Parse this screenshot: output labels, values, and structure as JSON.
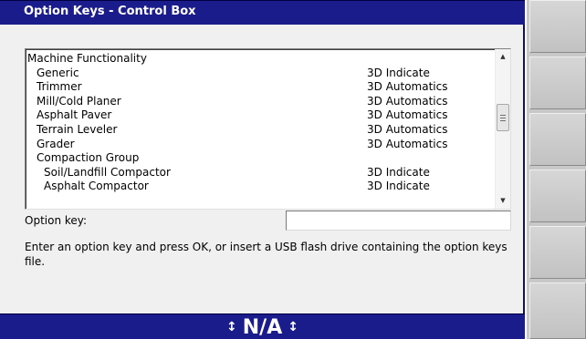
{
  "window": {
    "title": "Option Keys - Control Box"
  },
  "list": {
    "items": [
      {
        "name": "Machine Functionality",
        "value": "",
        "level": 0
      },
      {
        "name": "Generic",
        "value": "3D Indicate",
        "level": 1
      },
      {
        "name": "Trimmer",
        "value": "3D Automatics",
        "level": 1
      },
      {
        "name": "Mill/Cold Planer",
        "value": "3D Automatics",
        "level": 1
      },
      {
        "name": "Asphalt Paver",
        "value": "3D Automatics",
        "level": 1
      },
      {
        "name": "Terrain Leveler",
        "value": "3D Automatics",
        "level": 1
      },
      {
        "name": "Grader",
        "value": "3D Automatics",
        "level": 1
      },
      {
        "name": "Compaction Group",
        "value": "",
        "level": 1
      },
      {
        "name": "Soil/Landfill Compactor",
        "value": "3D Indicate",
        "level": 2
      },
      {
        "name": "Asphalt Compactor",
        "value": "3D Indicate",
        "level": 2
      }
    ]
  },
  "option_key": {
    "label": "Option key:",
    "value": "",
    "placeholder": ""
  },
  "instructions": "Enter an option key and press OK, or insert a USB flash drive containing the option keys file.",
  "status": {
    "text": "N/A",
    "icon_left": "up-down-arrow-icon",
    "icon_right": "up-down-arrow-icon"
  },
  "colors": {
    "title_bar": "#1b1c8c",
    "status_bar": "#1b1c8c",
    "panel": "#f0f0f0",
    "softkey": "#c8c8c8"
  }
}
